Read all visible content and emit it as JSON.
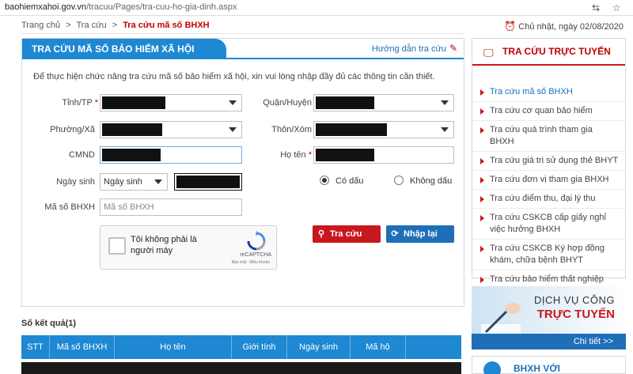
{
  "browser": {
    "url_host": "baohiemxahoi.gov.vn",
    "url_path": "/tracuu/Pages/tra-cuu-ho-gia-dinh.aspx",
    "icons": [
      "translate-icon",
      "star-icon"
    ]
  },
  "breadcrumb": {
    "home": "Trang chủ",
    "sep1": ">",
    "section": "Tra cứu",
    "sep2": ">",
    "current": "Tra cứu mã số BHXH"
  },
  "date": {
    "text": "Chủ nhật, ngày 02/08/2020",
    "icon": "alarm-icon"
  },
  "panel": {
    "title": "TRA CỨU MÃ SỐ BẢO HIỂM XÃ HỘI",
    "guide_label": "Hướng dẫn tra cứu",
    "intro": "Để thực hiện chức năng tra cứu mã số bảo hiểm xã hội, xin vui lòng nhập đầy đủ các thông tin cần thiết."
  },
  "form": {
    "province_label": "Tỉnh/TP",
    "district_label": "Quận/Huyện",
    "ward_label": "Phường/Xã",
    "hamlet_label": "Thôn/Xóm",
    "id_label": "CMND",
    "name_label": "Họ tên",
    "required_mark": "*",
    "dob_label": "Ngày sinh",
    "dob_select": "Ngày sinh",
    "accent_on": "Có dấu",
    "accent_off": "Không dấu",
    "bhxh_label": "Mã số BHXH",
    "bhxh_placeholder": "Mã số BHXH"
  },
  "captcha": {
    "text": "Tôi không phải là người máy",
    "brand": "reCAPTCHA",
    "terms": "Bảo mật - Điều khoản"
  },
  "buttons": {
    "search": "Tra cứu",
    "reset": "Nhập lại"
  },
  "results": {
    "title": "Số kết quả(1)",
    "columns": [
      "STT",
      "Mã số BHXH",
      "Họ tên",
      "Giới tính",
      "Ngày sinh",
      "Mã hộ"
    ]
  },
  "sidebar": {
    "title": "TRA CỨU TRỰC TUYẾN",
    "items": [
      "Tra cứu mã số BHXH",
      "Tra cứu cơ quan bảo hiểm",
      "Tra cứu quá trình tham gia BHXH",
      "Tra cứu giá trị sử dụng thẻ BHYT",
      "Tra cứu đơn vị tham gia BHXH",
      "Tra cứu điểm thu, đại lý thu",
      "Tra cứu CSKCB cấp giấy nghỉ việc hưởng BHXH",
      "Tra cứu CSKCB Ký hợp đồng khám, chữa bệnh BHYT",
      "Tra cứu bảo hiểm thất nghiệp"
    ]
  },
  "banner": {
    "line1": "DỊCH VỤ CÔNG",
    "line2": "TRỰC TUYẾN",
    "more": "Chi tiết >>"
  },
  "sidebar2": {
    "title": "BHXH VỚI"
  },
  "colors": {
    "primary": "#1e88d2",
    "danger": "#c8171e",
    "link": "#1e6fb8"
  }
}
